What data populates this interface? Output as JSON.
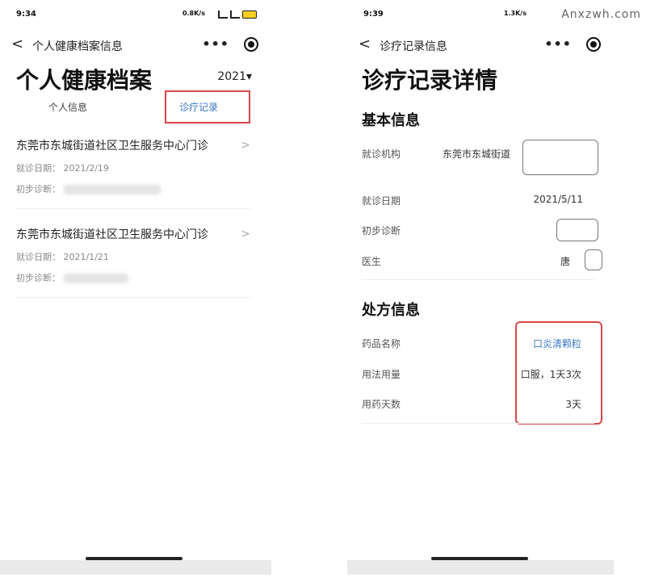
{
  "watermark": "Anxzwh.com",
  "left": {
    "status": {
      "time": "9:34",
      "net": "0.8K/s"
    },
    "nav": {
      "back": "<",
      "title": "个人健康档案信息",
      "more": "•••"
    },
    "title": "个人健康档案",
    "year": "2021▾",
    "tabs": [
      "个人信息",
      "诊疗记录"
    ],
    "records": [
      {
        "name": "东莞市东城街道社区卫生服务中心门诊",
        "date_label": "就诊日期：",
        "date": "2021/2/19",
        "diag_label": "初步诊断：",
        "chev": ">"
      },
      {
        "name": "东莞市东城街道社区卫生服务中心门诊",
        "date_label": "就诊日期：",
        "date": "2021/1/21",
        "diag_label": "初步诊断：",
        "chev": ">"
      }
    ]
  },
  "right": {
    "status": {
      "time": "9:39",
      "net": "1.3K/s"
    },
    "nav": {
      "back": "<",
      "title": "诊疗记录信息",
      "more": "•••"
    },
    "title": "诊疗记录详情",
    "basic": {
      "heading": "基本信息",
      "institution_label": "就诊机构",
      "institution_value": "东莞市东城街道",
      "date_label": "就诊日期",
      "date_value": "2021/5/11",
      "diag_label": "初步诊断",
      "doctor_label": "医生",
      "doctor_value": "唐"
    },
    "prescription": {
      "heading": "处方信息",
      "drug_label": "药品名称",
      "drug_value": "口炎清颗粒",
      "usage_label": "用法用量",
      "usage_value": "口服，1天3次",
      "days_label": "用药天数",
      "days_value": "3天"
    }
  },
  "colors": {
    "accent": "#3a78c4",
    "highlight": "#d74747"
  }
}
